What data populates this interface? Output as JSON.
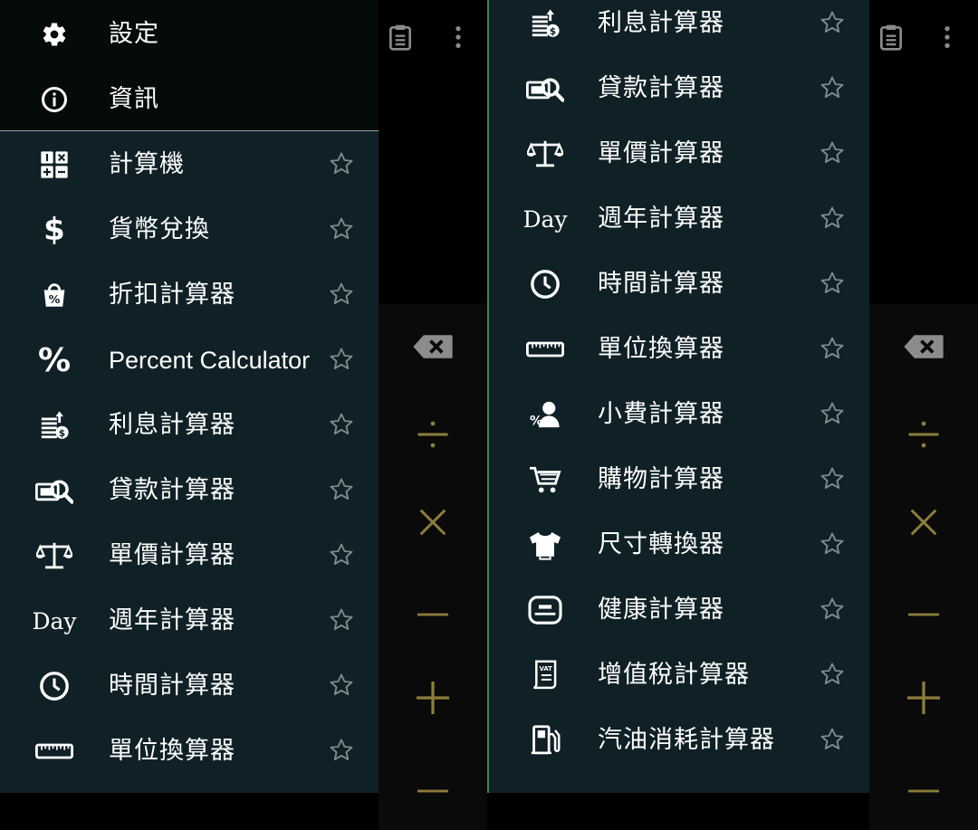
{
  "left_drawer": {
    "header_items": [
      {
        "label": "設定",
        "icon": "gear-icon"
      },
      {
        "label": "資訊",
        "icon": "info-icon"
      }
    ],
    "items": [
      {
        "label": "計算機",
        "icon": "calculator-icon"
      },
      {
        "label": "貨幣兌換",
        "icon": "dollar-icon"
      },
      {
        "label": "折扣計算器",
        "icon": "discount-bag-icon"
      },
      {
        "label": "Percent Calculator",
        "icon": "percent-icon"
      },
      {
        "label": "利息計算器",
        "icon": "interest-coins-icon"
      },
      {
        "label": "貸款計算器",
        "icon": "loan-icon"
      },
      {
        "label": "單價計算器",
        "icon": "scale-icon"
      },
      {
        "label": "週年計算器",
        "icon": "day-text-icon",
        "icon_text": "Day"
      },
      {
        "label": "時間計算器",
        "icon": "clock-icon"
      },
      {
        "label": "單位換算器",
        "icon": "ruler-icon"
      }
    ]
  },
  "right_drawer": {
    "items": [
      {
        "label": "利息計算器",
        "icon": "interest-coins-icon"
      },
      {
        "label": "貸款計算器",
        "icon": "loan-icon"
      },
      {
        "label": "單價計算器",
        "icon": "scale-icon"
      },
      {
        "label": "週年計算器",
        "icon": "day-text-icon",
        "icon_text": "Day"
      },
      {
        "label": "時間計算器",
        "icon": "clock-icon"
      },
      {
        "label": "單位換算器",
        "icon": "ruler-icon"
      },
      {
        "label": "小費計算器",
        "icon": "tip-icon"
      },
      {
        "label": "購物計算器",
        "icon": "cart-icon"
      },
      {
        "label": "尺寸轉換器",
        "icon": "shirt-icon"
      },
      {
        "label": "健康計算器",
        "icon": "bathroom-scale-icon"
      },
      {
        "label": "增值稅計算器",
        "icon": "vat-receipt-icon"
      },
      {
        "label": "汽油消耗計算器",
        "icon": "fuel-pump-icon"
      }
    ]
  },
  "calculator_strip": {
    "keys": [
      "backspace-icon",
      "divide-icon",
      "multiply-icon",
      "minus-icon",
      "plus-icon"
    ],
    "toolbar": [
      "clipboard-icon",
      "more-vert-icon"
    ]
  },
  "colors": {
    "drawer_bg": "#0f2126",
    "operator_olive": "#8d7d3b",
    "star_gray": "#7b8c90",
    "accent_green": "#3b8a3b"
  }
}
